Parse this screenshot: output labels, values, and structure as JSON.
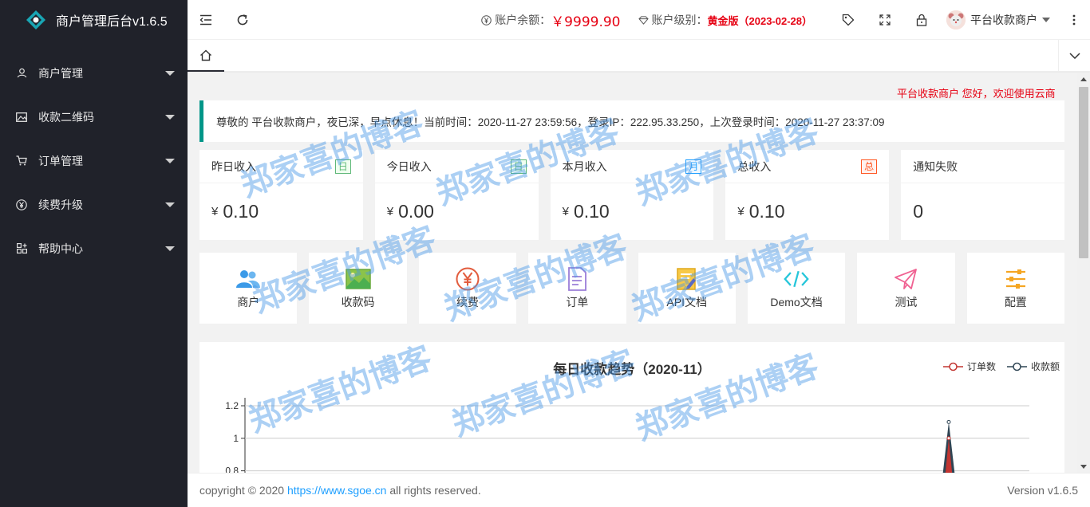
{
  "app": {
    "title": "商户管理后台v1.6.5"
  },
  "sidebar": {
    "items": [
      {
        "label": "商户管理",
        "icon": "user-icon"
      },
      {
        "label": "收款二维码",
        "icon": "image-icon"
      },
      {
        "label": "订单管理",
        "icon": "cart-icon"
      },
      {
        "label": "续费升级",
        "icon": "yen-circle-icon"
      },
      {
        "label": "帮助中心",
        "icon": "apps-icon"
      }
    ]
  },
  "header": {
    "balance_label": "账户余额：",
    "balance_value": "￥9999.90",
    "level_label": "账户级别：",
    "level_value": "黄金版（2023-02-28）",
    "user_name": "平台收款商户"
  },
  "marquee": "平台收款商户 您好，欢迎使用云商",
  "notice": "尊敬的 平台收款商户，夜已深，早点休息！当前时间：2020-11-27 23:59:56，登录IP：222.95.33.250，上次登录时间：2020-11-27 23:37:09",
  "stats": [
    {
      "label": "昨日收入",
      "badge": "日",
      "badge_color": "green",
      "yen": "¥",
      "value": "0.10"
    },
    {
      "label": "今日收入",
      "badge": "日",
      "badge_color": "green",
      "yen": "¥",
      "value": "0.00"
    },
    {
      "label": "本月收入",
      "badge": "月",
      "badge_color": "blue",
      "yen": "¥",
      "value": "0.10"
    },
    {
      "label": "总收入",
      "badge": "总",
      "badge_color": "red",
      "yen": "¥",
      "value": "0.10"
    },
    {
      "label": "通知失败",
      "badge": "",
      "badge_color": "",
      "yen": "",
      "value": "0"
    }
  ],
  "shortcuts": [
    {
      "label": "商户",
      "icon": "users-icon"
    },
    {
      "label": "收款码",
      "icon": "picture-icon"
    },
    {
      "label": "续费",
      "icon": "yen-circle-icon"
    },
    {
      "label": "订单",
      "icon": "document-icon"
    },
    {
      "label": "API文档",
      "icon": "doc-edit-icon"
    },
    {
      "label": "Demo文档",
      "icon": "code-icon"
    },
    {
      "label": "测试",
      "icon": "paper-plane-icon"
    },
    {
      "label": "配置",
      "icon": "sliders-icon"
    }
  ],
  "chart_data": {
    "type": "line",
    "title": "每日收款趋势（2020-11）",
    "series": [
      {
        "name": "订单数",
        "color": "#c23531"
      },
      {
        "name": "收款额",
        "color": "#2f4554"
      }
    ],
    "y_ticks": [
      "1.2",
      "1",
      "0.8"
    ],
    "ylim": [
      0.8,
      1.2
    ],
    "peak": {
      "订单数": 1,
      "收款额": 1.1
    },
    "legend_position": "top-right"
  },
  "footer": {
    "copyright": "copyright © 2020 ",
    "link": "https://www.sgoe.cn",
    "rights": " all rights reserved.",
    "version": "Version v1.6.5"
  },
  "watermark": "郑家喜的博客"
}
